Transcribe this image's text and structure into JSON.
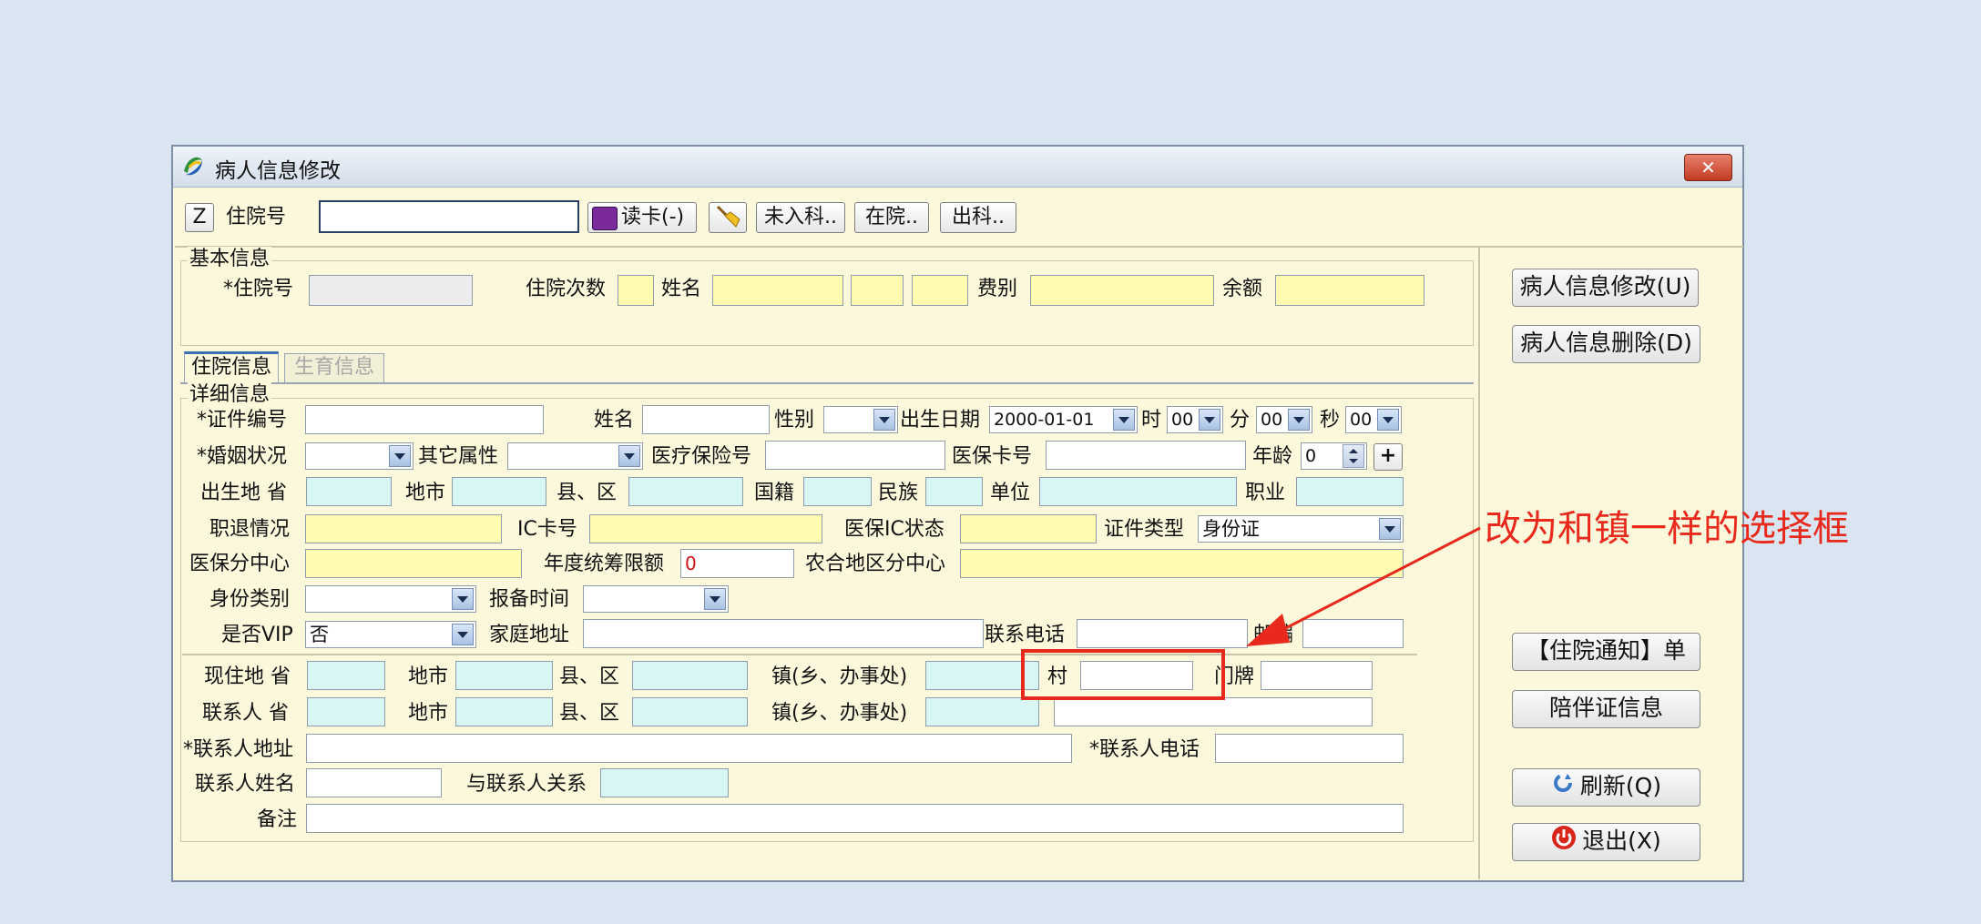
{
  "window": {
    "title": "病人信息修改",
    "close": "✕"
  },
  "toolbar": {
    "z_label": "Z",
    "admission_label": "住院号",
    "admission_value": "",
    "read_card": "读卡(-)",
    "not_admitted": "未入科..",
    "in_hospital": "在院..",
    "discharged": "出科.."
  },
  "basic": {
    "legend": "基本信息",
    "admission_no": "*住院号",
    "times": "住院次数",
    "name": "姓名",
    "fee_type": "费别",
    "balance": "余额"
  },
  "tabs": {
    "inpatient": "住院信息",
    "birth": "生育信息"
  },
  "detail": {
    "legend": "详细信息",
    "id_no": "*证件编号",
    "name": "姓名",
    "gender": "性别",
    "birth_date_label": "出生日期",
    "birth_date": "2000-01-01",
    "hour_label": "时",
    "hour": "00",
    "minute_label": "分",
    "minute": "00",
    "second_label": "秒",
    "second": "00",
    "marital": "*婚姻状况",
    "other_attr": "其它属性",
    "insurance_no": "医疗保险号",
    "insurance_card": "医保卡号",
    "age_label": "年龄",
    "age": "0",
    "birthplace_prov": "出生地 省",
    "city": "地市",
    "county": "县、区",
    "nationality": "国籍",
    "ethnicity": "民族",
    "employer": "单位",
    "occupation": "职业",
    "retirement": "职退情况",
    "ic_no": "IC卡号",
    "ic_status": "医保IC状态",
    "id_type_label": "证件类型",
    "id_type": "身份证",
    "center": "医保分中心",
    "annual_limit_label": "年度统筹限额",
    "annual_limit": "0",
    "rural_center": "农合地区分中心",
    "identity": "身份类别",
    "record_time": "报备时间",
    "vip_label": "是否VIP",
    "vip": "否",
    "home_addr": "家庭地址",
    "phone": "联系电话",
    "zip": "邮编"
  },
  "address": {
    "cur_prov": "现住地 省",
    "city": "地市",
    "county": "县、区",
    "town": "镇(乡、办事处)",
    "village": "村",
    "house_no": "门牌",
    "contact_prov": "联系人 省",
    "contact_addr": "*联系人地址",
    "contact_phone": "*联系人电话",
    "contact_name": "联系人姓名",
    "relation": "与联系人关系",
    "remark": "备注"
  },
  "side": {
    "modify": "病人信息修改(U)",
    "delete": "病人信息删除(D)",
    "notice": "【住院通知】单",
    "escort": "陪伴证信息",
    "refresh": "刷新(Q)",
    "exit": "退出(X)"
  },
  "annotation": {
    "text": "改为和镇一样的选择框",
    "color": "#e8291c"
  }
}
